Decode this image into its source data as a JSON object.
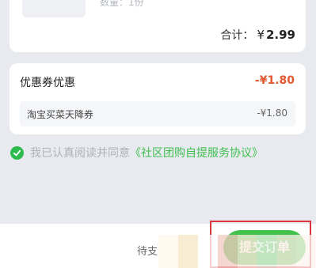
{
  "order": {
    "quantity_text": "数量：1份",
    "total_label": "合计：",
    "total_currency": "¥",
    "total_amount": "2.99"
  },
  "coupon": {
    "title": "优惠券优惠",
    "total_discount": "-¥1.80",
    "items": [
      {
        "name": "淘宝买菜天降券",
        "value": "-¥1.80"
      }
    ]
  },
  "agreement": {
    "text": "我已认真阅读并同意",
    "link": "《社区团购自提服务协议》",
    "checked": true
  },
  "footer": {
    "pending_label": "待支",
    "submit_label": "提交订单"
  },
  "colors": {
    "accent_green": "#43c24b",
    "discount_red": "#e05a33",
    "highlight_red": "#d9363e"
  }
}
